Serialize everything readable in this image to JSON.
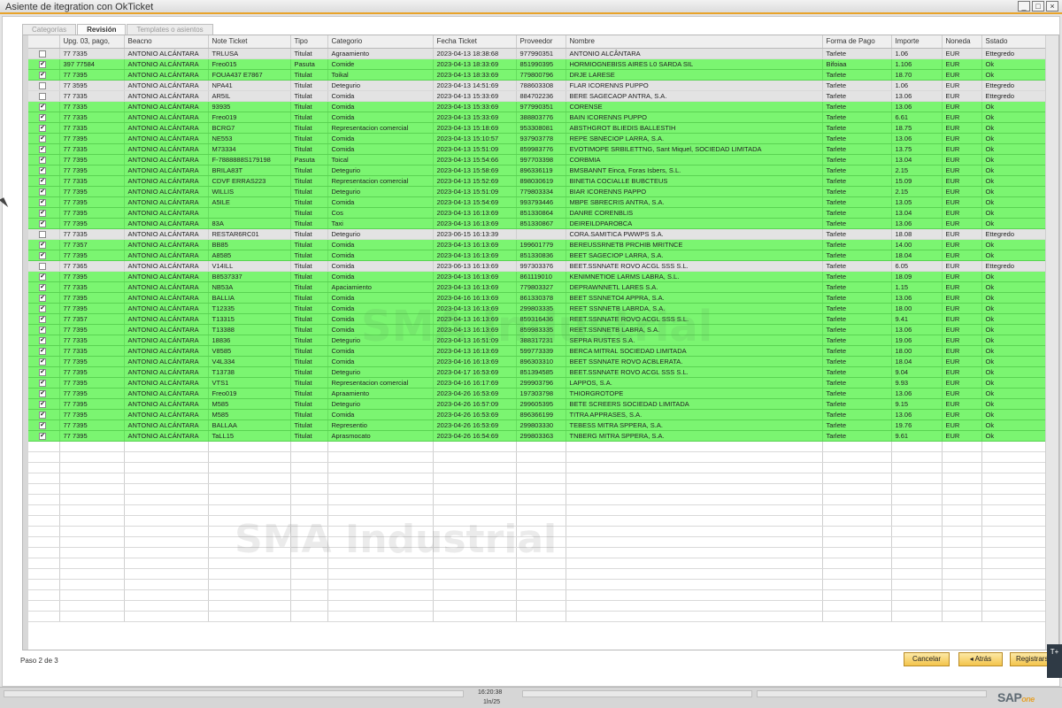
{
  "window": {
    "title": "Asiente de itegration con OkTicket",
    "controls": [
      "_",
      "□",
      "×"
    ]
  },
  "tabs": [
    {
      "label": "Categorías"
    },
    {
      "label": "Revisión"
    },
    {
      "label": "Templates o asientos"
    }
  ],
  "grid": {
    "columns": [
      "Upg. 03, pago,",
      "Beacno",
      "Note Ticket",
      "Tipo",
      "Categorio",
      "Fecha Ticket",
      "Proveedor",
      "Nombre",
      "Forma de Pago",
      "Importe",
      "Noneda",
      "Sstado"
    ],
    "rows": [
      {
        "state": "pend",
        "checked": false,
        "cells": [
          "77 7335",
          "ANTONIO ALCÁNTARA",
          "TRLUSA",
          "Titulat",
          "Agraamiento",
          "2023-04-13 18:38:68",
          "977990351",
          "ANTONIO ALCÂNTARA",
          "Tarlete",
          "1.06",
          "EUR",
          "Ettegredo"
        ]
      },
      {
        "state": "ok",
        "checked": true,
        "cells": [
          "397 77584",
          "ANTONIO ALCÁNTARA",
          "Freo015",
          "Pasuta",
          "Comide",
          "2023-04-13 18:33:69",
          "851990395",
          "HORMIOGNEBISS AIRES L0 SARDA SIL",
          "Bifoiaa",
          "1.106",
          "EUR",
          "Ok"
        ]
      },
      {
        "state": "ok",
        "checked": true,
        "cells": [
          "77 7395",
          "ANTONIO ALCÁNTARA",
          "FOUA437 E7867",
          "Titulat",
          "Toikal",
          "2023-04-13 18:33:69",
          "779800796",
          "DRJE LARESE",
          "Tarlete",
          "18.70",
          "EUR",
          "Ok"
        ]
      },
      {
        "state": "pend",
        "checked": false,
        "cells": [
          "77 3595",
          "ANTONIO ALCÁNTARA",
          "NPA41",
          "Titulat",
          "Detegurio",
          "2023-04-13 14:51:69",
          "788603308",
          "FLAR ICORENNS PUPPO",
          "Tarlete",
          "1.06",
          "EUR",
          "Ettegredo"
        ]
      },
      {
        "state": "pend",
        "checked": false,
        "cells": [
          "77 7335",
          "ANTONIO ALCÁNTARA",
          "AR5IL",
          "Titulat",
          "Comida",
          "2023-04-13 15:33:69",
          "884702236",
          "BERE SAGECAOP ANTRA, S.A.",
          "Tarlete",
          "13.06",
          "EUR",
          "Ettegredo"
        ]
      },
      {
        "state": "ok",
        "checked": true,
        "cells": [
          "77 7335",
          "ANTONIO ALCÁNTARA",
          "93935",
          "Titulat",
          "Comida",
          "2023-04-13 15:33:69",
          "977990351",
          "CORENSE",
          "Tarlete",
          "13.06",
          "EUR",
          "Ok"
        ]
      },
      {
        "state": "ok",
        "checked": true,
        "cells": [
          "77 7335",
          "ANTONIO ALCÁNTARA",
          "Freo019",
          "Titulat",
          "Comida",
          "2023-04-13 15:33:69",
          "388803776",
          "BAIN ICORENNS PUPPO",
          "Tarlete",
          "6.61",
          "EUR",
          "Ok"
        ]
      },
      {
        "state": "ok",
        "checked": true,
        "cells": [
          "77 7335",
          "ANTONIO ALCÁNTARA",
          "BCRG7",
          "Titulat",
          "Representacion comercial",
          "2023-04-13 15:18:69",
          "953308081",
          "ABSTHGROT BLIEDIS BALLESTIH",
          "Tarlete",
          "18.75",
          "EUR",
          "Ok"
        ]
      },
      {
        "state": "ok",
        "checked": true,
        "cells": [
          "77 7395",
          "ANTONIO ALCÁNTARA",
          "NE553",
          "Titulat",
          "Comida",
          "2023-04-13 15:10:57",
          "937903778",
          "REPE SBNECIOP LARRA, S.A.",
          "Tarlete",
          "13.06",
          "EUR",
          "Ok"
        ]
      },
      {
        "state": "ok",
        "checked": true,
        "cells": [
          "77 7335",
          "ANTONIO ALCÁNTARA",
          "M73334",
          "Titulat",
          "Comida",
          "2023-04-13 15:51:09",
          "859983776",
          "EVOTIMOPE SRBILETTNG, Sant Miquel, SOCIEDAD LIMITADA",
          "Tarlete",
          "13.75",
          "EUR",
          "Ok"
        ]
      },
      {
        "state": "ok",
        "checked": true,
        "cells": [
          "77 7395",
          "ANTONIO ALCÁNTARA",
          "F-7888888S179198",
          "Pasuta",
          "Toical",
          "2023-04-13 15:54:66",
          "997703398",
          "CORBMIA",
          "Tarlete",
          "13.04",
          "EUR",
          "Ok"
        ]
      },
      {
        "state": "ok",
        "checked": true,
        "cells": [
          "77 7395",
          "ANTONIO ALCÁNTARA",
          "BRILA83T",
          "Titulat",
          "Detegurio",
          "2023-04-13 15:58:69",
          "896336119",
          "BMSBANNT Einca, Foras Isbers, S.L.",
          "Tarlete",
          "2.15",
          "EUR",
          "Ok"
        ]
      },
      {
        "state": "ok",
        "checked": true,
        "cells": [
          "77 7335",
          "ANTONIO ALCÁNTARA",
          "CDVF ERRAS223",
          "Titulat",
          "Representacion comercial",
          "2023-04-13 15:52:69",
          "898030619",
          "BINETIA COCIALLE BUBCTEUS",
          "Tarlete",
          "15.09",
          "EUR",
          "Ok"
        ]
      },
      {
        "state": "ok",
        "checked": true,
        "cells": [
          "77 7395",
          "ANTONIO ALCÁNTARA",
          "WILLIS",
          "Titulat",
          "Detegurio",
          "2023-04-13 15:51:09",
          "779803334",
          "BIAR ICORENNS PAPPO",
          "Tarlete",
          "2.15",
          "EUR",
          "Ok"
        ]
      },
      {
        "state": "ok",
        "checked": true,
        "cells": [
          "77 7395",
          "ANTONIO ALCÁNTARA",
          "A5ILE",
          "Titulat",
          "Comida",
          "2023-04-13 15:54:69",
          "993793446",
          "MBPE SBRECRIS ANTRA, S.A.",
          "Tarlete",
          "13.05",
          "EUR",
          "Ok"
        ]
      },
      {
        "state": "ok",
        "checked": true,
        "cells": [
          "77 7395",
          "ANTONIO ALCÁNTARA",
          "",
          "Titulat",
          "Cos",
          "2023-04-13 16:13:69",
          "851330864",
          "DANRE CORENBLIS",
          "Tarlete",
          "13.04",
          "EUR",
          "Ok"
        ]
      },
      {
        "state": "ok",
        "checked": true,
        "cells": [
          "77 7395",
          "ANTONIO ALCÁNTARA",
          "83A",
          "Titulat",
          "Taxi",
          "2023-04-13 16:13:69",
          "851330867",
          "DEIREILDPAROBCA",
          "Tarlete",
          "13.06",
          "EUR",
          "Ok"
        ]
      },
      {
        "state": "pend",
        "checked": false,
        "cells": [
          "77 7335",
          "ANTONIO ALCÁNTARA",
          "RESTAR6RC01",
          "Titulat",
          "Detegurio",
          "2023-06-15 16:13:39",
          "",
          "CORA.SAMITICA PWWPS S.A.",
          "Tarlete",
          "18.08",
          "EUR",
          "Ettegredo"
        ]
      },
      {
        "state": "ok",
        "checked": true,
        "cells": [
          "77 7357",
          "ANTONIO ALCÁNTARA",
          "BB85",
          "Titulat",
          "Comida",
          "2023-04-13 16:13:69",
          "199601779",
          "BEREUSSRNETB PRCHIB MRITNCE",
          "Tarlete",
          "14.00",
          "EUR",
          "Ok"
        ]
      },
      {
        "state": "ok",
        "checked": true,
        "cells": [
          "77 7395",
          "ANTONIO ALCÁNTARA",
          "A8585",
          "Titulat",
          "Comida",
          "2023-04-13 16:13:69",
          "851330836",
          "BEET SAGECIOP LARRA, S.A.",
          "Tarlete",
          "18.04",
          "EUR",
          "Ok"
        ]
      },
      {
        "state": "pend",
        "checked": false,
        "cells": [
          "77 7365",
          "ANTONIO ALCÁNTARA",
          "V14ILL",
          "Titulat",
          "Comida",
          "2023-06-13 16:13:69",
          "997303376",
          "BEET.SSNNATE ROVO ACGL SSS S.L.",
          "Tarlete",
          "6.05",
          "EUR",
          "Ettegredo"
        ]
      },
      {
        "state": "ok",
        "checked": true,
        "cells": [
          "77 7395",
          "ANTONIO ALCÁNTARA",
          "B8537337",
          "Titulat",
          "Comida",
          "2023-04-13 16:13:69",
          "861119010",
          "KENIMNETIOE LARMS LABRA, S.L.",
          "Tarlete",
          "18.09",
          "EUR",
          "Ok"
        ]
      },
      {
        "state": "ok",
        "checked": true,
        "cells": [
          "77 7335",
          "ANTONIO ALCÁNTARA",
          "NB53A",
          "Titulat",
          "Apaciamiento",
          "2023-04-13 16:13:69",
          "779803327",
          "DEPRAWNNETL LARES S.A.",
          "Tarlete",
          "1.15",
          "EUR",
          "Ok"
        ]
      },
      {
        "state": "ok",
        "checked": true,
        "cells": [
          "77 7395",
          "ANTONIO ALCÁNTARA",
          "BALLIA",
          "Titulat",
          "Comida",
          "2023-04-16 16:13:69",
          "861330378",
          "BEET SSNNETO4 APPRA, S.A.",
          "Tarlete",
          "13.06",
          "EUR",
          "Ok"
        ]
      },
      {
        "state": "ok",
        "checked": true,
        "cells": [
          "77 7395",
          "ANTONIO ALCÁNTARA",
          "T12335",
          "Titulat",
          "Comida",
          "2023-04-13 16:13:69",
          "299803335",
          "REET SSNNETB LABRDA, S.A.",
          "Tarlete",
          "18.00",
          "EUR",
          "Ok"
        ]
      },
      {
        "state": "ok",
        "checked": true,
        "cells": [
          "77 7357",
          "ANTONIO ALCÁNTARA",
          "T13315",
          "Titulat",
          "Comida",
          "2023-04-13 16:13:69",
          "859316436",
          "REET.SSNNATE ROVO ACGL SSS S.L.",
          "Tarlete",
          "9.41",
          "EUR",
          "Ok"
        ]
      },
      {
        "state": "ok",
        "checked": true,
        "cells": [
          "77 7395",
          "ANTONIO ALCÁNTARA",
          "T13388",
          "Titulat",
          "Comida",
          "2023-04-13 16:13:69",
          "859983335",
          "REET.SSNNETB LABRA, S.A.",
          "Tarlete",
          "13.06",
          "EUR",
          "Ok"
        ]
      },
      {
        "state": "ok",
        "checked": true,
        "cells": [
          "77 7335",
          "ANTONIO ALCÁNTARA",
          "18836",
          "Titulat",
          "Detegurio",
          "2023-04-13 16:51:09",
          "388317231",
          "SEPRA RUSTES S.A.",
          "Tarlete",
          "19.06",
          "EUR",
          "Ok"
        ]
      },
      {
        "state": "ok",
        "checked": true,
        "cells": [
          "77 7335",
          "ANTONIO ALCÁNTARA",
          "V8585",
          "Titulat",
          "Comida",
          "2023-04-13 16:13:69",
          "599773339",
          "BERCA MITRAL SOCIEDAD LIMITADA",
          "Tarlete",
          "18.00",
          "EUR",
          "Ok"
        ]
      },
      {
        "state": "ok",
        "checked": true,
        "cells": [
          "77 7395",
          "ANTONIO ALCÁNTARA",
          "V4L334",
          "Titulat",
          "Comida",
          "2023-04-16 16:13:69",
          "896303310",
          "BEET SSNNATE ROVO ACBLERATA.",
          "Tarlete",
          "18.04",
          "EUR",
          "Ok"
        ]
      },
      {
        "state": "ok",
        "checked": true,
        "cells": [
          "77 7395",
          "ANTONIO ALCÁNTARA",
          "T13738",
          "Titulat",
          "Detegurio",
          "2023-04-17 16:53:69",
          "851394585",
          "BEET.SSNNATE ROVO ACGL SSS S.L.",
          "Tarlete",
          "9.04",
          "EUR",
          "Ok"
        ]
      },
      {
        "state": "ok",
        "checked": true,
        "cells": [
          "77 7395",
          "ANTONIO ALCÁNTARA",
          "VTS1",
          "Titulat",
          "Representacion comercial",
          "2023-04-16 16:17:69",
          "299903796",
          "LAPPOS, S.A.",
          "Tarlete",
          "9.93",
          "EUR",
          "Ok"
        ]
      },
      {
        "state": "ok",
        "checked": true,
        "cells": [
          "77 7395",
          "ANTONIO ALCÁNTARA",
          "Freo019",
          "Titulat",
          "Apraamiento",
          "2023-04-26 16:53:69",
          "197303798",
          "THIORGROTOPE",
          "Tarlete",
          "13.06",
          "EUR",
          "Ok"
        ]
      },
      {
        "state": "ok",
        "checked": true,
        "cells": [
          "77 7395",
          "ANTONIO ALCÁNTARA",
          "M585",
          "Titulat",
          "Detegurio",
          "2023-04-26 16:57:09",
          "299605395",
          "BETE SCREERS SOCIEDAD LIMITADA",
          "Tarlete",
          "9.15",
          "EUR",
          "Ok"
        ]
      },
      {
        "state": "ok",
        "checked": true,
        "cells": [
          "77 7395",
          "ANTONIO ALCÁNTARA",
          "M585",
          "Titulat",
          "Comida",
          "2023-04-26 16:53:69",
          "896366199",
          "TITRA APPRASES, S.A.",
          "Tarlete",
          "13.06",
          "EUR",
          "Ok"
        ]
      },
      {
        "state": "ok",
        "checked": true,
        "cells": [
          "77 7395",
          "ANTONIO ALCÁNTARA",
          "BALLAA",
          "Titulat",
          "Representio",
          "2023-04-26 16:53:69",
          "299803330",
          "TEBESS MITRA SPPERA, S.A.",
          "Tarlete",
          "19.76",
          "EUR",
          "Ok"
        ]
      },
      {
        "state": "ok",
        "checked": true,
        "cells": [
          "77 7395",
          "ANTONIO ALCÁNTARA",
          "TaLL15",
          "Titulat",
          "Aprasmocato",
          "2023-04-26 16:54:69",
          "299803363",
          "TNBERG MITRA SPPERA, S.A.",
          "Tarlete",
          "9.61",
          "EUR",
          "Ok"
        ]
      }
    ]
  },
  "footer": {
    "step": "Paso 2 de 3",
    "cancel_label": "Cancelar",
    "back_label": "◂ Atrás",
    "register_label": "Registrarse"
  },
  "watermark": "SMA Industrial",
  "statusbar": {
    "time": "16:20:38",
    "date": "1ln/25"
  },
  "brand": {
    "logo": "SAP",
    "edition": "one"
  },
  "side_widget": {
    "label": "T+"
  },
  "colors": {
    "ok_row": "#7bf571",
    "pending_row": "#e3e3e3",
    "accent": "#e8a32a",
    "button": "#f3c44c"
  },
  "icons": {
    "window_controls": [
      "minimize-icon",
      "maximize-icon",
      "close-icon"
    ],
    "checkbox": "check-icon",
    "cursor": "mouse-pointer-icon"
  }
}
